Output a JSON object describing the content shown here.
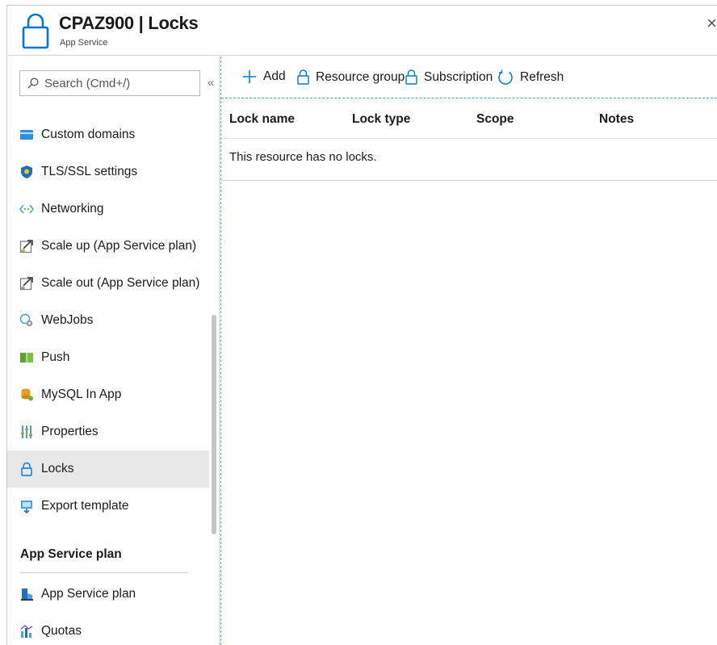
{
  "header": {
    "title": "CPAZ900 | Locks",
    "subtitle": "App Service",
    "close_glyph": "×",
    "icon": "lock-icon"
  },
  "sidebar": {
    "search_placeholder": "Search (Cmd+/)",
    "collapse_glyph": "«",
    "items": [
      {
        "label": "Custom domains",
        "icon": "custom-domains-icon"
      },
      {
        "label": "TLS/SSL settings",
        "icon": "shield-icon"
      },
      {
        "label": "Networking",
        "icon": "networking-icon"
      },
      {
        "label": "Scale up (App Service plan)",
        "icon": "scale-up-icon"
      },
      {
        "label": "Scale out (App Service plan)",
        "icon": "scale-out-icon"
      },
      {
        "label": "WebJobs",
        "icon": "webjobs-icon"
      },
      {
        "label": "Push",
        "icon": "push-icon"
      },
      {
        "label": "MySQL In App",
        "icon": "mysql-icon"
      },
      {
        "label": "Properties",
        "icon": "properties-icon"
      },
      {
        "label": "Locks",
        "icon": "lock-icon",
        "selected": true
      },
      {
        "label": "Export template",
        "icon": "export-template-icon"
      }
    ],
    "section": {
      "title": "App Service plan",
      "items": [
        {
          "label": "App Service plan",
          "icon": "app-service-plan-icon"
        },
        {
          "label": "Quotas",
          "icon": "quotas-icon"
        }
      ]
    }
  },
  "toolbar": {
    "add": "Add",
    "resource_group": "Resource group",
    "subscription": "Subscription",
    "refresh": "Refresh"
  },
  "table": {
    "columns": [
      "Lock name",
      "Lock type",
      "Scope",
      "Notes"
    ],
    "empty_message": "This resource has no locks."
  },
  "colors": {
    "accent": "#0078d4",
    "selected_bg": "#e8e8e8",
    "dashed_border": "#4aa3df"
  }
}
